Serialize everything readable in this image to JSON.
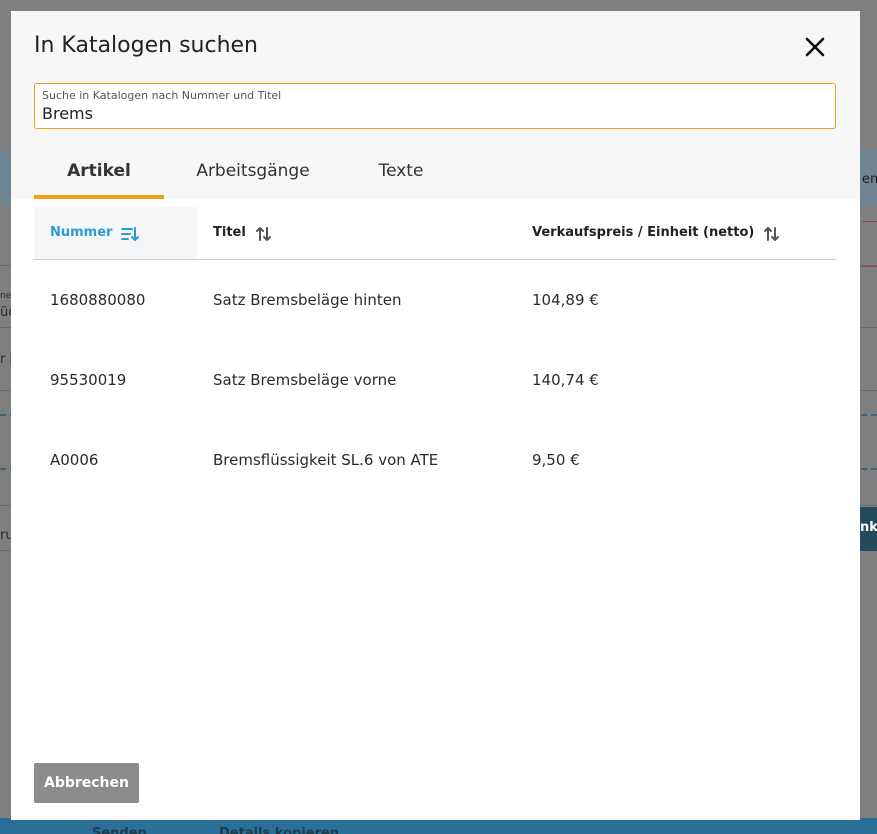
{
  "background": {
    "right_fragment": "en",
    "left_fragment_1": "ne",
    "left_fragment_2": "üc",
    "left_fragment_3": "r b",
    "left_fragment_4": "ru",
    "dark_button_fragment": "nko",
    "footer": {
      "send_label": "Senden",
      "copy_label": "Details kopieren"
    }
  },
  "dialog": {
    "title": "In Katalogen suchen",
    "search": {
      "label": "Suche in Katalogen nach Nummer und Titel",
      "value": "Brems"
    },
    "tabs": [
      {
        "label": "Artikel",
        "active": true
      },
      {
        "label": "Arbeitsgänge",
        "active": false
      },
      {
        "label": "Texte",
        "active": false
      }
    ],
    "table": {
      "columns": [
        "Nummer",
        "Titel",
        "Verkaufspreis / Einheit (netto)"
      ],
      "rows": [
        [
          "1680880080",
          "Satz Bremsbeläge hinten",
          "104,89 €"
        ],
        [
          "95530019",
          "Satz Bremsbeläge vorne",
          "140,74 €"
        ],
        [
          "A0006",
          "Bremsflüssigkeit SL.6 von ATE",
          "9,50 €"
        ]
      ]
    },
    "cancel_label": "Abbrechen"
  },
  "colors": {
    "accent": "#f0a21a",
    "active_sort": "#2b9bd6",
    "cancel_button": "#8c8c8c"
  }
}
